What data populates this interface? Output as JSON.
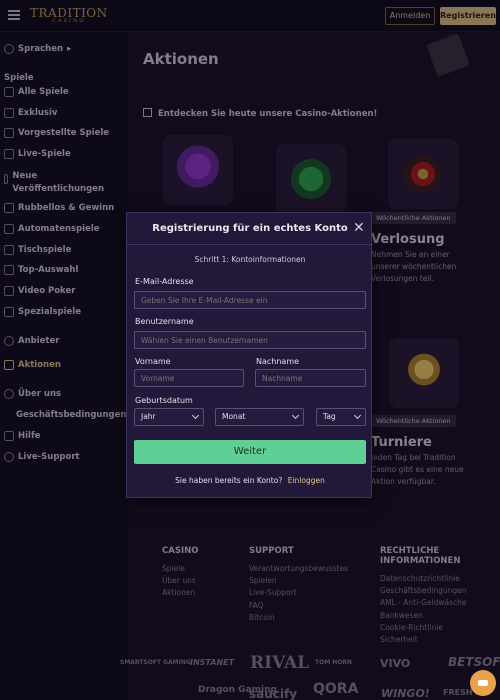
{
  "header": {
    "logo_text": "TRADITION",
    "logo_sub": "CASINO",
    "login_label": "Anmelden",
    "register_label": "Registrieren"
  },
  "sidebar": {
    "language": "Sprachen",
    "games_heading": "Spiele",
    "items": [
      {
        "label": "Alle Spiele",
        "icon": "home-icon"
      },
      {
        "label": "Exklusiv",
        "icon": "exclusive-icon"
      },
      {
        "label": "Vorgestellte Spiele",
        "icon": "star-icon"
      },
      {
        "label": "Live-Spiele",
        "icon": "live-icon"
      },
      {
        "label": "Neue Veröffentlichungen",
        "icon": "new-icon"
      },
      {
        "label": "Rubbellos & Gewinn",
        "icon": "scratch-icon"
      },
      {
        "label": "Automatenspiele",
        "icon": "slots-icon"
      },
      {
        "label": "Tischspiele",
        "icon": "table-icon"
      },
      {
        "label": "Top-Auswahl",
        "icon": "top-icon"
      },
      {
        "label": "Video Poker",
        "icon": "poker-icon"
      },
      {
        "label": "Spezialspiele",
        "icon": "special-icon"
      }
    ],
    "providers": "Anbieter",
    "promotions": "Aktionen",
    "about": "Über uns",
    "terms": "Geschäftsbedingungen",
    "help": "Hilfe",
    "live_support": "Live-Support"
  },
  "main": {
    "title": "Aktionen",
    "banner": "Entdecken Sie heute unsere Casino-Aktionen!",
    "weekly_badge": "Wöchentliche Aktionen",
    "lottery_title": "Verlosung",
    "lottery_desc_1": "Nehmen Sie an einer",
    "lottery_desc_2": "unserer wöchentlichen",
    "lottery_desc_3": "Verlosungen teil.",
    "tournament_badge": "Wöchentliche Aktionen",
    "tournament_title": "Turniere",
    "tournament_desc_1": "Jeden Tag bei Tradition",
    "tournament_desc_2": "Casino gibt es eine neue",
    "tournament_desc_3": "Aktion verfügbar."
  },
  "footer": {
    "casino": {
      "heading": "CASINO",
      "links": [
        "Spiele",
        "Über uns",
        "Aktionen"
      ]
    },
    "support": {
      "heading": "SUPPORT",
      "links": [
        "Verantwortungsbewusstes",
        "Spielen",
        "Live-Support",
        "FAQ",
        "Bitcoin"
      ]
    },
    "legal": {
      "heading": "RECHTLICHE INFORMATIONEN",
      "links": [
        "Datenschutzrichtlinie",
        "Geschäftsbedingungen",
        "AML - Anti-Geldwäsche",
        "Bankwesen",
        "Cookie-Richtlinie",
        "Sicherheit"
      ]
    },
    "providers": [
      "SMARTSOFT GAMING",
      "INSTANET",
      "RIVAL",
      "TOM HORN",
      "VIVO",
      "BETSOFT",
      "Dragon Gaming",
      "saucify",
      "QORA",
      "WINGO!",
      "FRESH"
    ]
  },
  "modal": {
    "title": "Registrierung für ein echtes Konto",
    "step": "Schritt 1: Kontoinformationen",
    "email_label": "E-Mail-Adresse",
    "email_placeholder": "Geben Sie Ihre E-Mail-Adresse ein",
    "username_label": "Benutzername",
    "username_placeholder": "Wählen Sie einen Benutzernamen",
    "firstname_label": "Vorname",
    "firstname_placeholder": "Vorname",
    "lastname_label": "Nachname",
    "lastname_placeholder": "Nachname",
    "birthdate_label": "Geburtsdatum",
    "year": "Jahr",
    "month": "Monat",
    "day": "Tag",
    "submit": "Weiter",
    "have_account": "Sie haben bereits ein Konto?",
    "login_link": "Einloggen"
  }
}
